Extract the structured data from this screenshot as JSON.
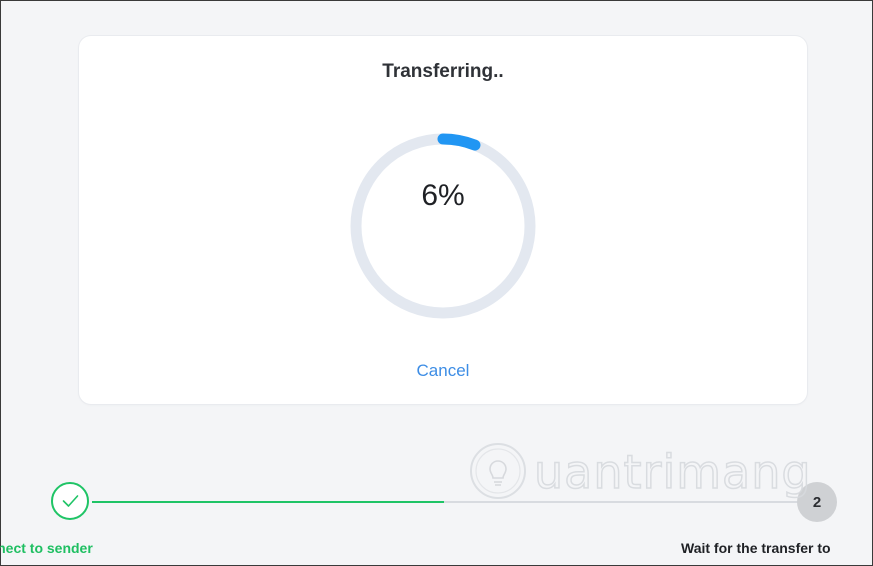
{
  "card": {
    "title": "Transferring..",
    "progress_text": "6%",
    "progress_fraction": 0.06,
    "cancel_label": "Cancel"
  },
  "stepper": {
    "step1_label": "onnect to sender",
    "step2_number": "2",
    "step2_label": "Wait for the transfer to"
  },
  "watermark": {
    "text": "uantrimang"
  },
  "colors": {
    "accent": "#2196f3",
    "ring_track": "#e3e8f0",
    "success": "#1fc466",
    "link": "#3d8de5"
  },
  "icons": {
    "step1": "check-icon",
    "watermark": "lightbulb-icon"
  }
}
